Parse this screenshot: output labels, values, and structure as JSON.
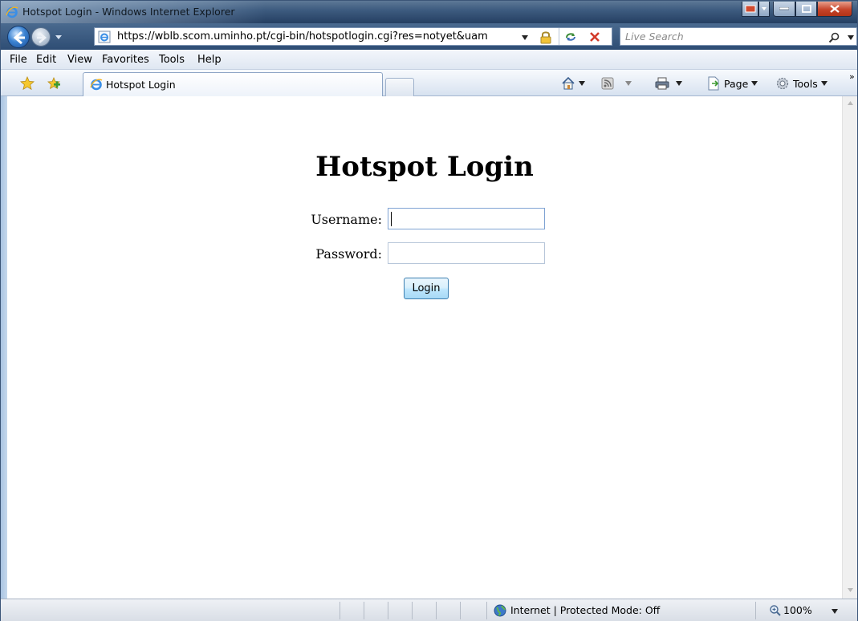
{
  "window": {
    "title": "Hotspot Login - Windows Internet Explorer"
  },
  "address_bar": {
    "url": "https://wblb.scom.uminho.pt/cgi-bin/hotspotlogin.cgi?res=notyet&uam"
  },
  "search": {
    "placeholder": "Live Search"
  },
  "menu": {
    "items": [
      "File",
      "Edit",
      "View",
      "Favorites",
      "Tools",
      "Help"
    ]
  },
  "tab": {
    "label": "Hotspot Login"
  },
  "command_bar": {
    "page_label": "Page",
    "tools_label": "Tools",
    "overflow": "»"
  },
  "page": {
    "heading": "Hotspot Login",
    "username_label": "Username:",
    "password_label": "Password:",
    "username_value": "",
    "password_value": "",
    "login_button": "Login"
  },
  "status_bar": {
    "zone": "Internet | Protected Mode: Off",
    "zoom": "100%"
  },
  "colors": {
    "titlebar": "#3e5c80",
    "button_border": "#3c7fb1",
    "input_border": "#b7c6d9"
  }
}
